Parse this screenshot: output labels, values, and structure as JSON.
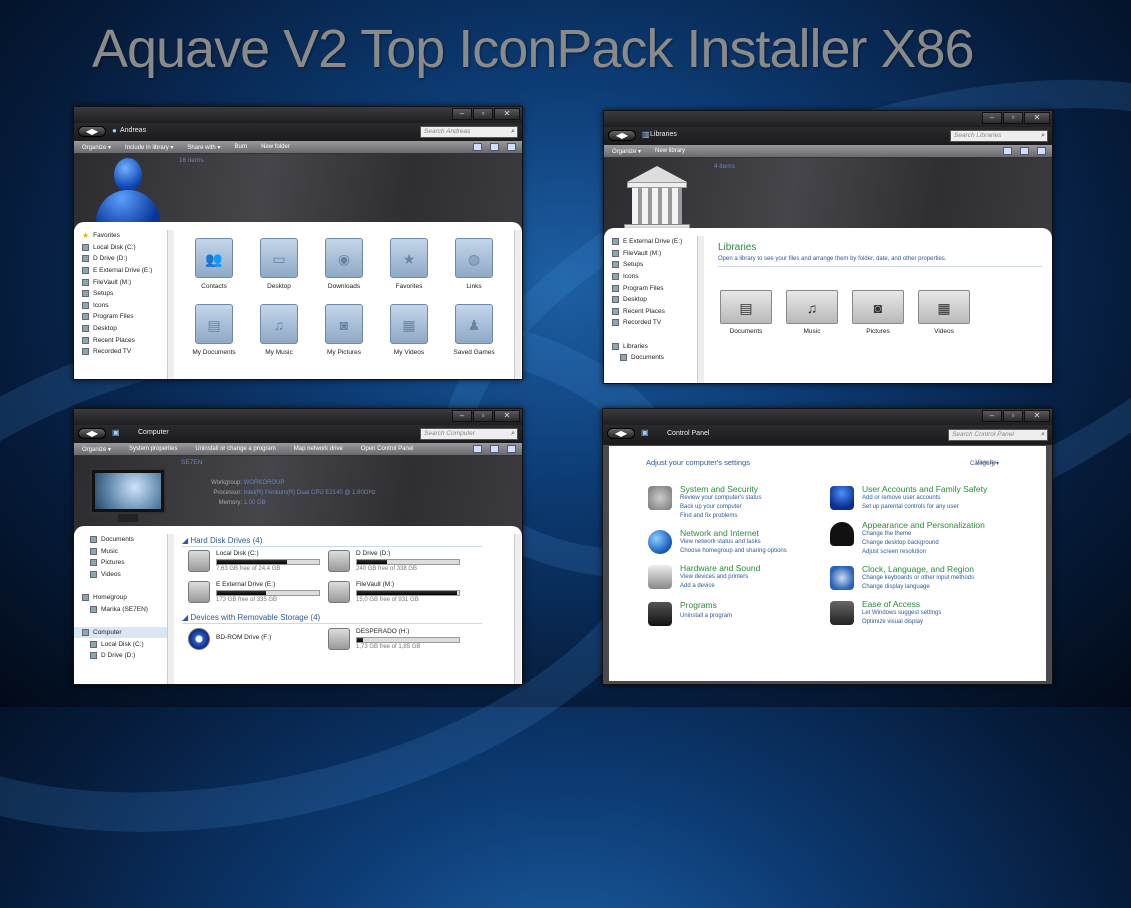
{
  "title": "Aquave V2 Top IconPack Installer X86",
  "window_controls": {
    "min": "–",
    "max": "▫",
    "close": "✕"
  },
  "user_window": {
    "path": "Andreas",
    "search": "Search Andreas",
    "toolbar": [
      "Organize ▾",
      "Include in library ▾",
      "Share with ▾",
      "Burn",
      "New folder"
    ],
    "item_count": "16 items",
    "nav": [
      "Favorites",
      "Local Disk (C:)",
      "D Drive (D:)",
      "E External Drive (E:)",
      "FileVault (M:)",
      "Setups",
      "Icons",
      "Program Files",
      "Desktop",
      "Recent Places",
      "Recorded TV"
    ],
    "folders": [
      "Contacts",
      "Desktop",
      "Downloads",
      "Favorites",
      "Links",
      "My Documents",
      "My Music",
      "My Pictures",
      "My Videos",
      "Saved Games"
    ]
  },
  "libraries_window": {
    "path": "Libraries",
    "search": "Search Libraries",
    "toolbar": [
      "Organize ▾",
      "New library"
    ],
    "item_count": "4 items",
    "nav": [
      "E External Drive (E:)",
      "FileVault (M:)",
      "Setups",
      "Icons",
      "Program Files",
      "Desktop",
      "Recent Places",
      "Recorded TV",
      "",
      "Libraries",
      "Documents"
    ],
    "heading": "Libraries",
    "subheading": "Open a library to see your files and arrange them by folder, date, and other properties.",
    "libraries": [
      "Documents",
      "Music",
      "Pictures",
      "Videos"
    ]
  },
  "computer_window": {
    "path": "Computer",
    "search": "Search Computer",
    "toolbar": [
      "Organize ▾",
      "System properties",
      "Uninstall or change a program",
      "Map network drive",
      "Open Control Panel"
    ],
    "pc_name": "SE7EN",
    "info": [
      {
        "k": "Workgroup:",
        "v": "WORKGROUP"
      },
      {
        "k": "Processor:",
        "v": "Intel(R) Pentium(R) Dual  CPU  E2140  @ 1.60GHz"
      },
      {
        "k": "Memory:",
        "v": "1.00 GB"
      }
    ],
    "nav": [
      "Documents",
      "Music",
      "Pictures",
      "Videos",
      "",
      "Homegroup",
      "Marika (SE7EN)",
      "",
      "Computer",
      "Local Disk (C:)",
      "D Drive (D:)"
    ],
    "hdd_section": "Hard Disk Drives (4)",
    "removable_section": "Devices with Removable Storage (4)",
    "drives": [
      {
        "name": "Local Disk (C:)",
        "free": "7,63 GB free of 24,4 GB",
        "used": 0.69
      },
      {
        "name": "D Drive (D:)",
        "free": "240 GB free of 338 GB",
        "used": 0.29
      },
      {
        "name": "E External Drive (E:)",
        "free": "173 GB free of 335 GB",
        "used": 0.48
      },
      {
        "name": "FileVault (M:)",
        "free": "15,0 GB free of 931 GB",
        "used": 0.98
      }
    ],
    "removable": [
      {
        "name": "BD-ROM Drive (F:)"
      },
      {
        "name": "DESPERADO (H:)",
        "free": "1,73 GB free of 1,85 GB",
        "used": 0.06
      }
    ]
  },
  "control_panel": {
    "path": "Control Panel",
    "search": "Search Control Panel",
    "heading": "Adjust your computer's settings",
    "viewby_label": "View by:",
    "viewby_value": "Category ▾",
    "left": [
      {
        "title": "System and Security",
        "links": [
          "Review your computer's status",
          "Back up your computer",
          "Find and fix problems"
        ],
        "color": "#7a7f8a"
      },
      {
        "title": "Network and Internet",
        "links": [
          "View network status and tasks",
          "Choose homegroup and sharing options"
        ],
        "color": "#2a72c8"
      },
      {
        "title": "Hardware and Sound",
        "links": [
          "View devices and printers",
          "Add a device"
        ],
        "color": "#9a9a9a"
      },
      {
        "title": "Programs",
        "links": [
          "Uninstall a program"
        ],
        "color": "#333"
      }
    ],
    "right": [
      {
        "title": "User Accounts and Family Safety",
        "links": [
          "Add or remove user accounts",
          "Set up parental controls for any user"
        ],
        "color": "#1b4fb0"
      },
      {
        "title": "Appearance and Personalization",
        "links": [
          "Change the theme",
          "Change desktop background",
          "Adjust screen resolution"
        ],
        "color": "#111"
      },
      {
        "title": "Clock, Language, and Region",
        "links": [
          "Change keyboards or other input methods",
          "Change display language"
        ],
        "color": "#2a62b8"
      },
      {
        "title": "Ease of Access",
        "links": [
          "Let Windows suggest settings",
          "Optimize visual display"
        ],
        "color": "#333"
      }
    ]
  }
}
